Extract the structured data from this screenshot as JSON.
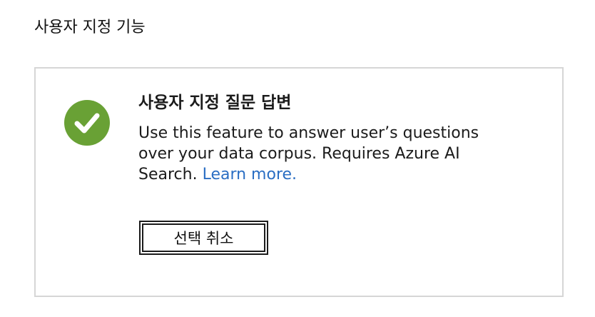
{
  "section": {
    "heading": "사용자 지정 기능"
  },
  "feature_card": {
    "status_icon": "check-circle-icon",
    "status_color": "#69a135",
    "title": "사용자 지정 질문 답변",
    "description": "Use this feature to answer user’s questions over your data corpus. Requires Azure AI Search.",
    "learn_more_label": "Learn more.",
    "link_color": "#2a6ec3",
    "deselect_button_label": "선택 취소"
  }
}
